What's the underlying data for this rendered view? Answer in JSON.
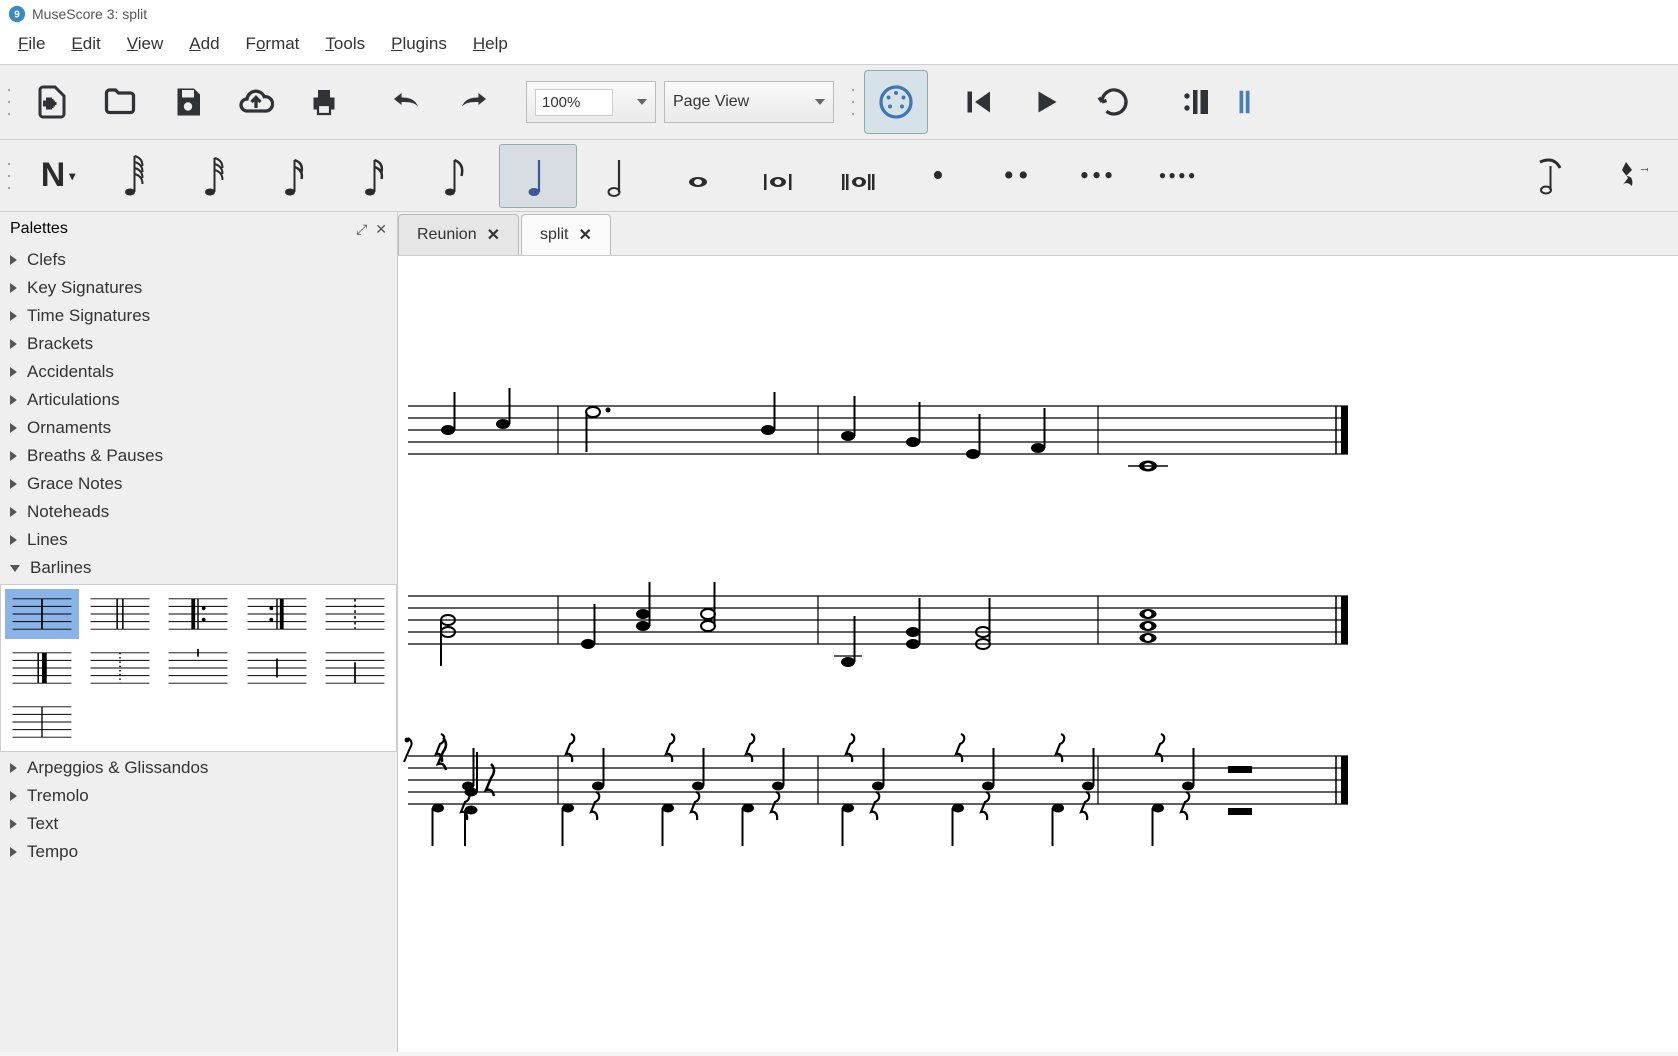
{
  "app": {
    "title": "MuseScore 3: split"
  },
  "menu": {
    "items": [
      "File",
      "Edit",
      "View",
      "Add",
      "Format",
      "Tools",
      "Plugins",
      "Help"
    ]
  },
  "toolbar1": {
    "zoom": "100%",
    "view_mode": "Page View"
  },
  "palettes": {
    "title": "Palettes",
    "items": [
      {
        "label": "Clefs",
        "expanded": false
      },
      {
        "label": "Key Signatures",
        "expanded": false
      },
      {
        "label": "Time Signatures",
        "expanded": false
      },
      {
        "label": "Brackets",
        "expanded": false
      },
      {
        "label": "Accidentals",
        "expanded": false
      },
      {
        "label": "Articulations",
        "expanded": false
      },
      {
        "label": "Ornaments",
        "expanded": false
      },
      {
        "label": "Breaths & Pauses",
        "expanded": false
      },
      {
        "label": "Grace Notes",
        "expanded": false
      },
      {
        "label": "Noteheads",
        "expanded": false
      },
      {
        "label": "Lines",
        "expanded": false
      },
      {
        "label": "Barlines",
        "expanded": true
      },
      {
        "label": "Arpeggios & Glissandos",
        "expanded": false
      },
      {
        "label": "Tremolo",
        "expanded": false
      },
      {
        "label": "Text",
        "expanded": false
      },
      {
        "label": "Tempo",
        "expanded": false
      }
    ],
    "barlines": [
      {
        "name": "normal",
        "selected": true
      },
      {
        "name": "double"
      },
      {
        "name": "start-repeat"
      },
      {
        "name": "end-repeat"
      },
      {
        "name": "dashed"
      },
      {
        "name": "final"
      },
      {
        "name": "dotted"
      },
      {
        "name": "tick"
      },
      {
        "name": "short"
      },
      {
        "name": "short2"
      },
      {
        "name": "single"
      }
    ]
  },
  "tabs": [
    {
      "label": "Reunion",
      "active": false
    },
    {
      "label": "split",
      "active": true
    }
  ],
  "note_toolbar": {
    "selected_index": 6,
    "items": [
      "note-input",
      "64th",
      "32nd-beamed",
      "32nd",
      "16th",
      "8th",
      "quarter",
      "half",
      "whole",
      "double-whole",
      "long",
      "dot",
      "double-dot",
      "triple-dot",
      "quad-dot",
      "flip",
      "tie-rest"
    ]
  }
}
